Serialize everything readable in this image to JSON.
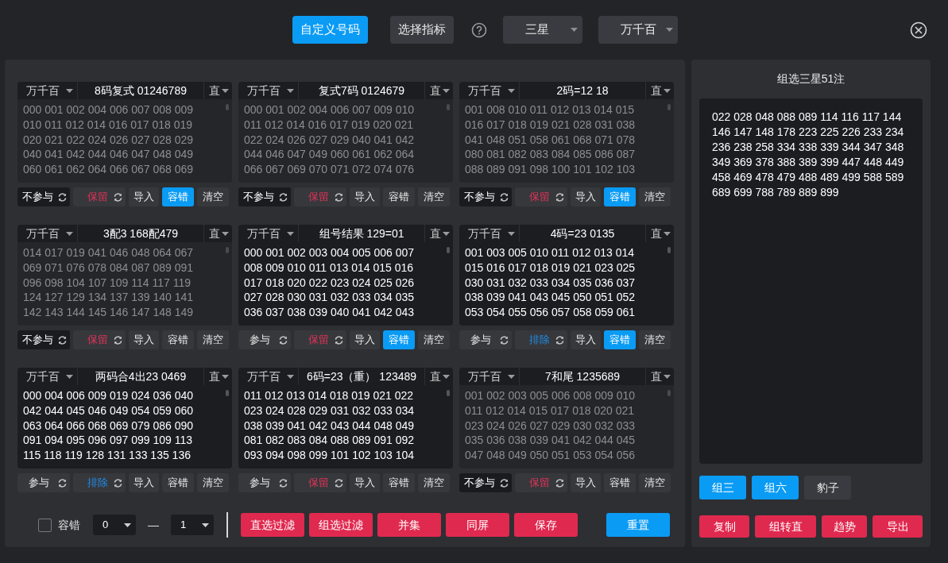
{
  "top_bar": {
    "tabs": [
      {
        "label": "自定义号码",
        "selected": true
      },
      {
        "label": "选择指标",
        "selected": false
      }
    ],
    "selects": [
      "三星",
      "万千百"
    ]
  },
  "cards": [
    {
      "position": "万千百",
      "title": "8码复式 01246789",
      "mode": "直",
      "active": false,
      "lines": [
        "000 001 002 004 006 007 008 009",
        "010 011 012 014 016 017 018 019",
        "020 021 022 024 026 027 028 029",
        "040 041 042 044 046 047 048 049",
        "060 061 062 064 066 067 068 069"
      ],
      "participate": {
        "label": "不参与",
        "on": false
      },
      "filter": {
        "label": "保留",
        "kind": "keep"
      },
      "import": "导入",
      "tolerance": {
        "label": "容错",
        "selected": true
      },
      "clear": "清空"
    },
    {
      "position": "万千百",
      "title": "复式7码 0124679",
      "mode": "直",
      "active": false,
      "lines": [
        "000 001 002 004 006 007 009 010",
        "011 012 014 016 017 019 020 021",
        "022 024 026 027 029 040 041 042",
        "044 046 047 049 060 061 062 064",
        "066 067 069 070 071 072 074 076"
      ],
      "participate": {
        "label": "不参与",
        "on": false
      },
      "filter": {
        "label": "保留",
        "kind": "keep"
      },
      "import": "导入",
      "tolerance": {
        "label": "容错",
        "selected": false
      },
      "clear": "清空"
    },
    {
      "position": "万千百",
      "title": "2码=12 18",
      "mode": "直",
      "active": false,
      "lines": [
        "001 008 010 011 012 013 014 015",
        "016 017 018 019 021 028 031 038",
        "041 048 051 058 061 068 071 078",
        "080 081 082 083 084 085 086 087",
        "088 089 091 098 100 101 102 103"
      ],
      "participate": {
        "label": "不参与",
        "on": false
      },
      "filter": {
        "label": "保留",
        "kind": "keep"
      },
      "import": "导入",
      "tolerance": {
        "label": "容错",
        "selected": true
      },
      "clear": "清空"
    },
    {
      "position": "万千百",
      "title": "3配3 168配479",
      "mode": "直",
      "active": false,
      "lines": [
        "014 017 019 041 046 048 064 067",
        "069 071 076 078 084 087 089 091",
        "096 098 104 107 109 114 117 119",
        "124 127 129 134 137 139 140 141",
        "142 143 144 145 146 147 148 149"
      ],
      "participate": {
        "label": "不参与",
        "on": false
      },
      "filter": {
        "label": "保留",
        "kind": "keep"
      },
      "import": "导入",
      "tolerance": {
        "label": "容错",
        "selected": false
      },
      "clear": "清空"
    },
    {
      "position": "万千百",
      "title": "组号结果 129=01",
      "mode": "直",
      "active": true,
      "lines": [
        "000 001 002 003 004 005 006 007",
        "008 009 010 011 013 014 015 016",
        "017 018 020 022 023 024 025 026",
        "027 028 030 031 032 033 034 035",
        "036 037 038 039 040 041 042 043"
      ],
      "participate": {
        "label": "参与",
        "on": true
      },
      "filter": {
        "label": "保留",
        "kind": "keep"
      },
      "import": "导入",
      "tolerance": {
        "label": "容错",
        "selected": true
      },
      "clear": "清空"
    },
    {
      "position": "万千百",
      "title": "4码=23 0135",
      "mode": "直",
      "active": true,
      "lines": [
        "001 003 005 010 011 012 013 014",
        "015 016 017 018 019 021 023 025",
        "030 031 032 033 034 035 036 037",
        "038 039 041 043 045 050 051 052",
        "053 054 055 056 057 058 059 061"
      ],
      "participate": {
        "label": "参与",
        "on": true
      },
      "filter": {
        "label": "排除",
        "kind": "exclude"
      },
      "import": "导入",
      "tolerance": {
        "label": "容错",
        "selected": true
      },
      "clear": "清空"
    },
    {
      "position": "万千百",
      "title": "两码合4出23 0469",
      "mode": "直",
      "active": true,
      "lines": [
        "000 004 006 009 019 024 036 040",
        "042 044 045 046 049 054 059 060",
        "063 064 066 068 069 079 086 090",
        "091 094 095 096 097 099 109 113",
        "115 118 119 128 131 133 135 136"
      ],
      "participate": {
        "label": "参与",
        "on": true
      },
      "filter": {
        "label": "排除",
        "kind": "exclude"
      },
      "import": "导入",
      "tolerance": {
        "label": "容错",
        "selected": false
      },
      "clear": "清空"
    },
    {
      "position": "万千百",
      "title": "6码=23（重） 123489",
      "mode": "直",
      "active": true,
      "lines": [
        "011 012 013 014 018 019 021 022",
        "023 024 028 029 031 032 033 034",
        "038 039 041 042 043 044 048 049",
        "081 082 083 084 088 089 091 092",
        "093 094 098 099 101 102 103 104"
      ],
      "participate": {
        "label": "参与",
        "on": true
      },
      "filter": {
        "label": "保留",
        "kind": "keep"
      },
      "import": "导入",
      "tolerance": {
        "label": "容错",
        "selected": false
      },
      "clear": "清空"
    },
    {
      "position": "万千百",
      "title": "7和尾 1235689",
      "mode": "直",
      "active": false,
      "lines": [
        "001 002 003 005 006 008 009 010",
        "011 012 014 015 017 018 020 021",
        "023 024 026 027 029 030 032 033",
        "035 036 038 039 041 042 044 045",
        "047 048 049 050 051 053 054 056"
      ],
      "participate": {
        "label": "不参与",
        "on": false
      },
      "filter": {
        "label": "保留",
        "kind": "keep"
      },
      "import": "导入",
      "tolerance": {
        "label": "容错",
        "selected": false
      },
      "clear": "清空"
    }
  ],
  "bottom_bar": {
    "tolerance": {
      "label": "容错",
      "checked": false
    },
    "range_from": "0",
    "range_dash": "—",
    "range_to": "1",
    "actions": [
      "直选过滤",
      "组选过滤",
      "并集",
      "同屏",
      "保存"
    ],
    "reset": "重置"
  },
  "result": {
    "title": "组选三星51注",
    "lines": [
      "022 028 048 088 089 114 116 117 144",
      "146 147 148 178 223 225 226 233 234",
      "236 238 258 334 338 339 344 347 348",
      "349 369 378 388 389 399 447 448 449",
      "458 469 478 479 488 489 499 588 589",
      "689 699 788 789 889 899"
    ],
    "groups": [
      {
        "label": "组三",
        "selected": true
      },
      {
        "label": "组六",
        "selected": true
      },
      {
        "label": "豹子",
        "selected": false
      }
    ],
    "actions": [
      "复制",
      "组转直",
      "趋势",
      "导出"
    ]
  }
}
